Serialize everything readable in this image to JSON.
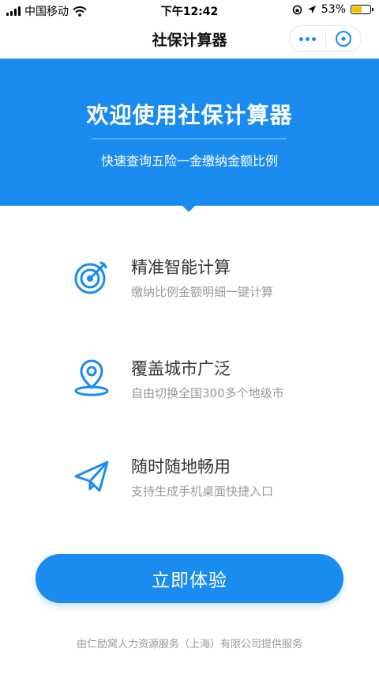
{
  "status_bar": {
    "carrier": "中国移动",
    "time": "下午12:42",
    "battery_percent": "53%",
    "battery_level": 0.53
  },
  "nav": {
    "title": "社保计算器"
  },
  "hero": {
    "title": "欢迎使用社保计算器",
    "subtitle": "快速查询五险一金缴纳金额比例"
  },
  "features": [
    {
      "icon": "target-icon",
      "title": "精准智能计算",
      "desc": "缴纳比例金额明细一键计算"
    },
    {
      "icon": "location-pin-icon",
      "title": "覆盖城市广泛",
      "desc": "自由切换全国300多个地级市"
    },
    {
      "icon": "paper-plane-icon",
      "title": "随时随地畅用",
      "desc": "支持生成手机桌面快捷入口"
    }
  ],
  "cta": {
    "label": "立即体验"
  },
  "footer": {
    "text": "由仁励窝人力资源服务（上海）有限公司提供服务"
  },
  "colors": {
    "accent": "#1a8cf0"
  }
}
